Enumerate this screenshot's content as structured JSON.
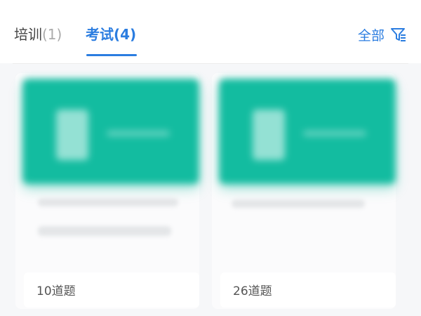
{
  "tabs": [
    {
      "label": "培训",
      "count": "(1)"
    },
    {
      "label": "考试",
      "count": "(4)"
    }
  ],
  "filter": {
    "label": "全部",
    "icon": "filter-icon"
  },
  "colors": {
    "accent": "#2b7de0",
    "card_thumbnail": "#13bca0"
  },
  "cards": [
    {
      "questions_label": "10道题"
    },
    {
      "questions_label": "26道题"
    }
  ]
}
